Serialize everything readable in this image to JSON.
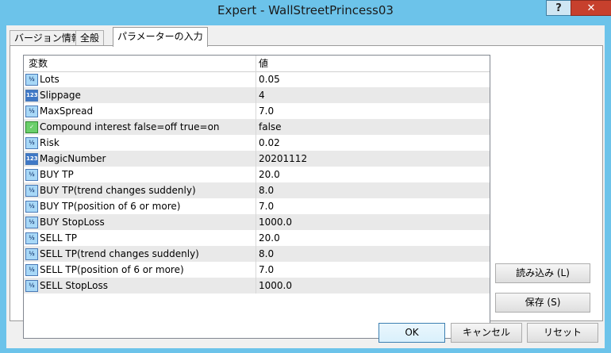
{
  "window": {
    "title": "Expert - WallStreetPrincess03",
    "help_label": "?",
    "close_label": "✕"
  },
  "tabs": [
    {
      "label": "バージョン情報"
    },
    {
      "label": "全般"
    },
    {
      "label": "パラメーターの入力"
    }
  ],
  "grid": {
    "columns": [
      "変数",
      "値"
    ],
    "rows": [
      {
        "icon": "half-icon",
        "glyph": "½",
        "name": "Lots",
        "value": "0.05"
      },
      {
        "icon": "number-icon",
        "glyph": "123",
        "name": "Slippage",
        "value": "4"
      },
      {
        "icon": "half-icon",
        "glyph": "½",
        "name": "MaxSpread",
        "value": "7.0"
      },
      {
        "icon": "boolean-icon",
        "glyph": "✓",
        "name": "Compound interest false=off true=on",
        "value": "false"
      },
      {
        "icon": "half-icon",
        "glyph": "½",
        "name": "Risk",
        "value": "0.02"
      },
      {
        "icon": "number-icon",
        "glyph": "123",
        "name": "MagicNumber",
        "value": "20201112"
      },
      {
        "icon": "half-icon",
        "glyph": "½",
        "name": "BUY TP",
        "value": "20.0"
      },
      {
        "icon": "half-icon",
        "glyph": "½",
        "name": "BUY TP(trend changes suddenly)",
        "value": "8.0"
      },
      {
        "icon": "half-icon",
        "glyph": "½",
        "name": "BUY TP(position of 6 or more)",
        "value": "7.0"
      },
      {
        "icon": "half-icon",
        "glyph": "½",
        "name": "BUY StopLoss",
        "value": "1000.0"
      },
      {
        "icon": "half-icon",
        "glyph": "½",
        "name": "SELL TP",
        "value": "20.0"
      },
      {
        "icon": "half-icon",
        "glyph": "½",
        "name": "SELL TP(trend changes suddenly)",
        "value": "8.0"
      },
      {
        "icon": "half-icon",
        "glyph": "½",
        "name": "SELL TP(position of 6 or more)",
        "value": "7.0"
      },
      {
        "icon": "half-icon",
        "glyph": "½",
        "name": "SELL StopLoss",
        "value": "1000.0"
      }
    ]
  },
  "buttons": {
    "load": "読み込み (L)",
    "save": "保存 (S)",
    "ok": "OK",
    "cancel": "キャンセル",
    "reset": "リセット"
  }
}
